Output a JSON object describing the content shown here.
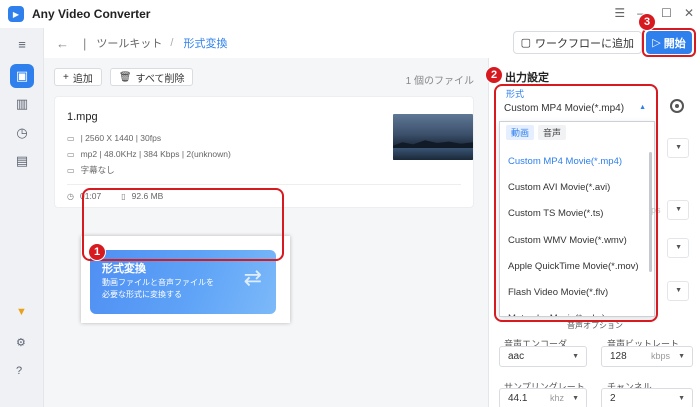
{
  "app": {
    "title": "Any Video Converter",
    "logo_icon": "app-logo-icon"
  },
  "window_controls": [
    "☰",
    "—",
    "☐",
    "✕"
  ],
  "toolbar": {
    "breadcrumb": [
      "ツールキット",
      "形式変換"
    ],
    "workflow_label": "ワークフローに追加",
    "start_label": "開始"
  },
  "actions": {
    "add_label": "追加",
    "delete_all_label": "すべて削除",
    "file_count": "1 個のファイル"
  },
  "file": {
    "name": "1.mpg",
    "video_meta": "| 2560 X 1440 | 30fps",
    "audio_meta": "mp2 | 48.0KHz | 384 Kbps | 2(unknown)",
    "subtitle_meta": "字幕なし",
    "duration": "01:07",
    "size": "92.6 MB"
  },
  "feature": {
    "title": "形式変換",
    "description": "動画ファイルと音声ファイルを必要な形式に変換する"
  },
  "badges": [
    "1",
    "2",
    "3"
  ],
  "output": {
    "title": "出力設定",
    "format_label": "形式",
    "format_value": "Custom MP4 Movie(*.mp4)",
    "tabs": [
      "動画",
      "音声"
    ],
    "options": [
      "Custom MP4 Movie(*.mp4)",
      "Custom AVI Movie(*.avi)",
      "Custom TS Movie(*.ts)",
      "Custom WMV Movie(*.wmv)",
      "Apple QuickTime Movie(*.mov)",
      "Flash Video Movie(*.flv)",
      "Matroska Movie(*.mkv)"
    ],
    "ghost_text": "ps",
    "audio_options_label": "音声オプション",
    "audio_encoder_label": "音声エンコーダ",
    "audio_encoder_value": "aac",
    "audio_bitrate_label": "音声ビットレート",
    "audio_bitrate_value": "128",
    "audio_bitrate_unit": "kbps",
    "sample_rate_label": "サンプリングレート",
    "sample_rate_value": "44.1",
    "sample_rate_unit": "khz",
    "channel_label": "チャンネル",
    "channel_value": "2"
  },
  "colors": {
    "accent": "#2f80ed",
    "highlight": "#d71920"
  }
}
